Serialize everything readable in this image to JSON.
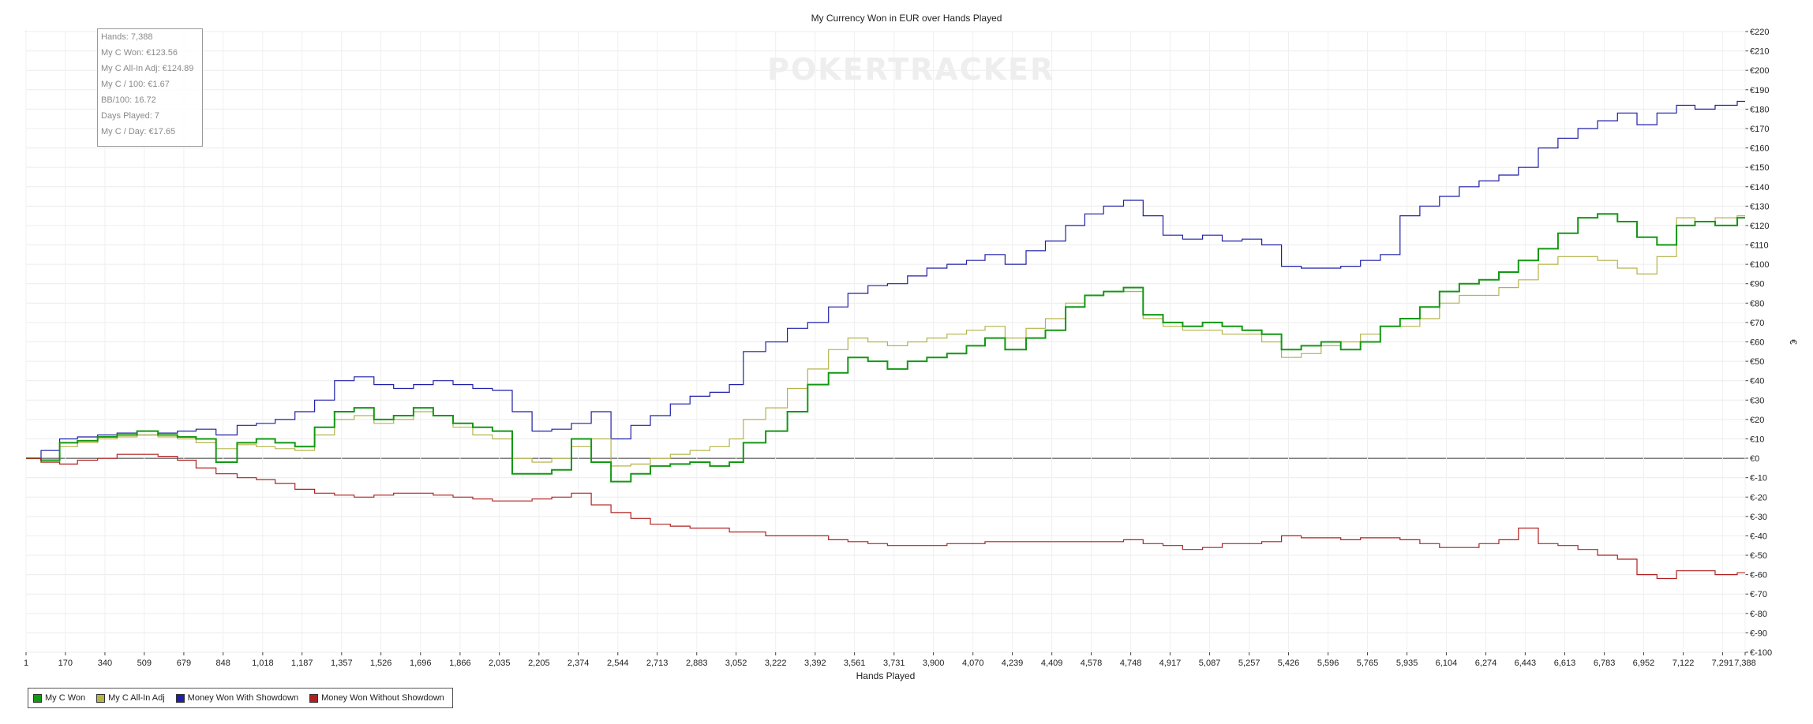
{
  "chart_data": {
    "type": "line",
    "title": "My Currency Won in EUR over Hands Played",
    "xlabel": "Hands Played",
    "ylabel": "€",
    "xlim": [
      1,
      7388
    ],
    "ylim": [
      -100,
      220
    ],
    "x_ticks": [
      1,
      170,
      340,
      509,
      679,
      848,
      1018,
      1187,
      1357,
      1526,
      1696,
      1866,
      2035,
      2205,
      2374,
      2544,
      2713,
      2883,
      3052,
      3222,
      3392,
      3561,
      3731,
      3900,
      4070,
      4239,
      4409,
      4578,
      4748,
      4917,
      5087,
      5257,
      5426,
      5596,
      5765,
      5935,
      6104,
      6274,
      6443,
      6613,
      6783,
      6952,
      7122,
      7291,
      7388
    ],
    "x_tick_labels": [
      "1",
      "170",
      "340",
      "509",
      "679",
      "848",
      "1,018",
      "1,187",
      "1,357",
      "1,526",
      "1,696",
      "1,866",
      "2,035",
      "2,205",
      "2,374",
      "2,544",
      "2,713",
      "2,883",
      "3,052",
      "3,222",
      "3,392",
      "3,561",
      "3,731",
      "3,900",
      "4,070",
      "4,239",
      "4,409",
      "4,578",
      "4,748",
      "4,917",
      "5,087",
      "5,257",
      "5,426",
      "5,596",
      "5,765",
      "5,935",
      "6,104",
      "6,274",
      "6,443",
      "6,613",
      "6,783",
      "6,952",
      "7,122",
      "7,291",
      "7,388"
    ],
    "y_ticks": [
      -100,
      -90,
      -80,
      -70,
      -60,
      -50,
      -40,
      -30,
      -20,
      -10,
      0,
      10,
      20,
      30,
      40,
      50,
      60,
      70,
      80,
      90,
      100,
      110,
      120,
      130,
      140,
      150,
      160,
      170,
      180,
      190,
      200,
      210,
      220
    ],
    "y_tick_labels": [
      "€-100",
      "€-90",
      "€-80",
      "€-70",
      "€-60",
      "€-50",
      "€-40",
      "€-30",
      "€-20",
      "€-10",
      "€0",
      "€10",
      "€20",
      "€30",
      "€40",
      "€50",
      "€60",
      "€70",
      "€80",
      "€90",
      "€100",
      "€110",
      "€120",
      "€130",
      "€140",
      "€150",
      "€160",
      "€170",
      "€180",
      "€190",
      "€200",
      "€210",
      "€220"
    ],
    "grid": true,
    "legend_position": "bottom-left",
    "series": [
      {
        "name": "Money Won With Showdown",
        "color": "#1f1fa8",
        "x": [
          1,
          100,
          170,
          250,
          340,
          420,
          509,
          600,
          679,
          760,
          848,
          940,
          1018,
          1100,
          1187,
          1270,
          1357,
          1440,
          1526,
          1610,
          1696,
          1780,
          1866,
          1950,
          2035,
          2120,
          2205,
          2290,
          2374,
          2460,
          2544,
          2630,
          2713,
          2800,
          2883,
          2970,
          3052,
          3100,
          3222,
          3300,
          3392,
          3480,
          3561,
          3650,
          3731,
          3820,
          3900,
          3990,
          4070,
          4150,
          4239,
          4330,
          4409,
          4500,
          4578,
          4660,
          4748,
          4830,
          4917,
          5000,
          5087,
          5170,
          5257,
          5340,
          5426,
          5510,
          5596,
          5680,
          5765,
          5850,
          5935,
          6020,
          6104,
          6190,
          6274,
          6360,
          6443,
          6530,
          6613,
          6700,
          6783,
          6870,
          6952,
          7040,
          7122,
          7200,
          7291,
          7388
        ],
        "y": [
          0,
          4,
          10,
          11,
          12,
          13,
          12,
          13,
          14,
          15,
          12,
          17,
          18,
          20,
          24,
          30,
          40,
          42,
          38,
          36,
          38,
          40,
          38,
          36,
          35,
          24,
          14,
          15,
          18,
          24,
          10,
          17,
          22,
          28,
          32,
          34,
          38,
          55,
          60,
          67,
          70,
          78,
          85,
          89,
          90,
          94,
          98,
          100,
          102,
          105,
          100,
          107,
          112,
          120,
          126,
          130,
          133,
          125,
          115,
          113,
          115,
          112,
          113,
          110,
          99,
          98,
          98,
          99,
          102,
          105,
          125,
          130,
          135,
          140,
          143,
          146,
          150,
          160,
          165,
          170,
          174,
          178,
          172,
          178,
          182,
          180,
          182,
          184
        ]
      },
      {
        "name": "My C All-In Adj",
        "color": "#b3b34a",
        "x": [
          1,
          100,
          170,
          250,
          340,
          420,
          509,
          600,
          679,
          760,
          848,
          940,
          1018,
          1100,
          1187,
          1270,
          1357,
          1440,
          1526,
          1610,
          1696,
          1780,
          1866,
          1950,
          2035,
          2120,
          2205,
          2290,
          2374,
          2460,
          2544,
          2630,
          2713,
          2800,
          2883,
          2970,
          3052,
          3100,
          3222,
          3300,
          3392,
          3480,
          3561,
          3650,
          3731,
          3820,
          3900,
          3990,
          4070,
          4150,
          4239,
          4330,
          4409,
          4500,
          4578,
          4660,
          4748,
          4830,
          4917,
          5000,
          5087,
          5170,
          5257,
          5340,
          5426,
          5510,
          5596,
          5680,
          5765,
          5850,
          5935,
          6020,
          6104,
          6190,
          6274,
          6360,
          6443,
          6530,
          6613,
          6700,
          6783,
          6870,
          6952,
          7040,
          7122,
          7200,
          7291,
          7388
        ],
        "y": [
          0,
          -2,
          6,
          8,
          10,
          11,
          12,
          11,
          10,
          8,
          5,
          7,
          6,
          5,
          4,
          12,
          20,
          22,
          18,
          20,
          24,
          22,
          16,
          12,
          10,
          0,
          -2,
          0,
          6,
          10,
          -4,
          -3,
          0,
          2,
          4,
          6,
          10,
          20,
          26,
          36,
          46,
          56,
          62,
          60,
          58,
          60,
          62,
          64,
          66,
          68,
          62,
          67,
          72,
          80,
          84,
          86,
          86,
          72,
          68,
          66,
          66,
          64,
          64,
          60,
          52,
          54,
          58,
          60,
          64,
          68,
          68,
          72,
          80,
          84,
          84,
          88,
          92,
          100,
          104,
          104,
          102,
          98,
          95,
          104,
          124,
          122,
          124,
          125
        ]
      },
      {
        "name": "My C Won",
        "color": "#139813",
        "x": [
          1,
          100,
          170,
          250,
          340,
          420,
          509,
          600,
          679,
          760,
          848,
          940,
          1018,
          1100,
          1187,
          1270,
          1357,
          1440,
          1526,
          1610,
          1696,
          1780,
          1866,
          1950,
          2035,
          2120,
          2205,
          2290,
          2374,
          2460,
          2544,
          2630,
          2713,
          2800,
          2883,
          2970,
          3052,
          3100,
          3222,
          3300,
          3392,
          3480,
          3561,
          3650,
          3731,
          3820,
          3900,
          3990,
          4070,
          4150,
          4239,
          4330,
          4409,
          4500,
          4578,
          4660,
          4748,
          4830,
          4917,
          5000,
          5087,
          5170,
          5257,
          5340,
          5426,
          5510,
          5596,
          5680,
          5765,
          5850,
          5935,
          6020,
          6104,
          6190,
          6274,
          6360,
          6443,
          6530,
          6613,
          6700,
          6783,
          6870,
          6952,
          7040,
          7122,
          7200,
          7291,
          7388
        ],
        "y": [
          0,
          -1,
          8,
          9,
          11,
          12,
          14,
          12,
          11,
          10,
          -2,
          8,
          10,
          8,
          6,
          16,
          24,
          26,
          20,
          22,
          26,
          22,
          18,
          16,
          14,
          -8,
          -8,
          -6,
          10,
          -2,
          -12,
          -8,
          -4,
          -3,
          -2,
          -4,
          -2,
          8,
          14,
          24,
          38,
          44,
          52,
          50,
          46,
          50,
          52,
          54,
          58,
          62,
          56,
          62,
          66,
          78,
          84,
          86,
          88,
          74,
          70,
          68,
          70,
          68,
          66,
          64,
          56,
          58,
          60,
          56,
          60,
          68,
          72,
          78,
          86,
          90,
          92,
          96,
          102,
          108,
          116,
          124,
          126,
          122,
          114,
          110,
          120,
          122,
          120,
          124
        ]
      },
      {
        "name": "Money Won Without Showdown",
        "color": "#b02020",
        "x": [
          1,
          100,
          170,
          250,
          340,
          420,
          509,
          600,
          679,
          760,
          848,
          940,
          1018,
          1100,
          1187,
          1270,
          1357,
          1440,
          1526,
          1610,
          1696,
          1780,
          1866,
          1950,
          2035,
          2120,
          2205,
          2290,
          2374,
          2460,
          2544,
          2630,
          2713,
          2800,
          2883,
          2970,
          3052,
          3100,
          3222,
          3300,
          3392,
          3480,
          3561,
          3650,
          3731,
          3820,
          3900,
          3990,
          4070,
          4150,
          4239,
          4330,
          4409,
          4500,
          4578,
          4660,
          4748,
          4830,
          4917,
          5000,
          5087,
          5170,
          5257,
          5340,
          5426,
          5510,
          5596,
          5680,
          5765,
          5850,
          5935,
          6020,
          6104,
          6190,
          6274,
          6360,
          6443,
          6530,
          6613,
          6700,
          6783,
          6870,
          6952,
          7040,
          7122,
          7200,
          7291,
          7388
        ],
        "y": [
          0,
          -2,
          -3,
          -1,
          0,
          2,
          2,
          1,
          -1,
          -5,
          -8,
          -10,
          -11,
          -13,
          -16,
          -18,
          -19,
          -20,
          -19,
          -18,
          -18,
          -19,
          -20,
          -21,
          -22,
          -22,
          -21,
          -20,
          -18,
          -24,
          -28,
          -31,
          -34,
          -35,
          -36,
          -36,
          -38,
          -38,
          -40,
          -40,
          -40,
          -42,
          -43,
          -44,
          -45,
          -45,
          -45,
          -44,
          -44,
          -43,
          -43,
          -43,
          -43,
          -43,
          -43,
          -43,
          -42,
          -44,
          -45,
          -47,
          -46,
          -44,
          -44,
          -43,
          -40,
          -41,
          -41,
          -42,
          -41,
          -41,
          -42,
          -44,
          -46,
          -46,
          -44,
          -42,
          -36,
          -44,
          -45,
          -47,
          -50,
          -52,
          -60,
          -62,
          -58,
          -58,
          -60,
          -59
        ]
      }
    ]
  },
  "stats": {
    "hands": "Hands: 7,388",
    "my_c_won": "My C Won: €123.56",
    "all_in_adj": "My C All-In Adj: €124.89",
    "per_100": "My C / 100: €1.67",
    "bb_100": "BB/100: 16.72",
    "days_played": "Days Played: 7",
    "per_day": "My C / Day: €17.65"
  },
  "watermark": "POKERTRACKER",
  "legend": [
    {
      "label": "My C Won",
      "color": "#139813"
    },
    {
      "label": "My C All-In Adj",
      "color": "#b3b34a"
    },
    {
      "label": "Money Won With Showdown",
      "color": "#1f1fa8"
    },
    {
      "label": "Money Won Without Showdown",
      "color": "#b02020"
    }
  ]
}
